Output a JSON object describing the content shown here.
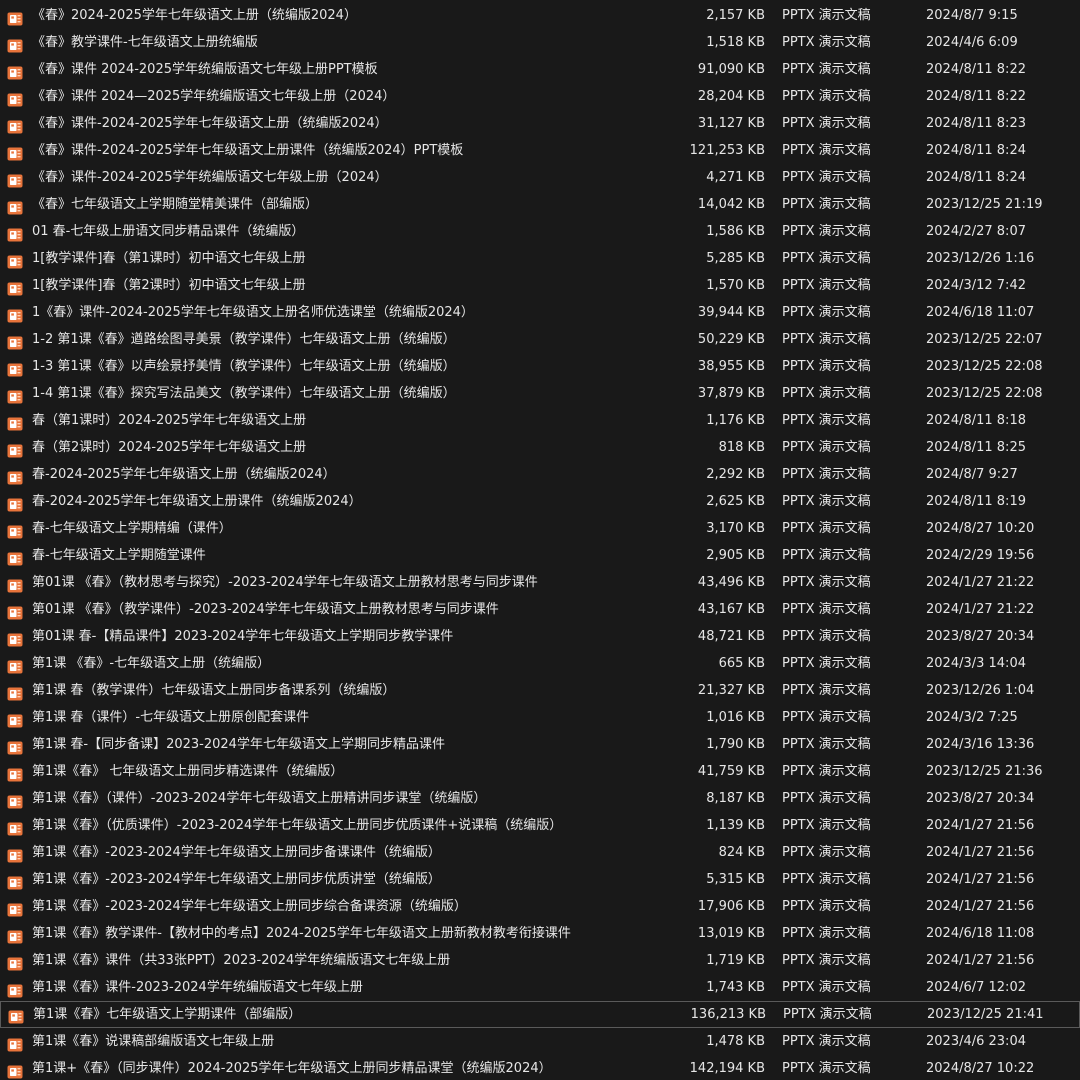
{
  "files": [
    {
      "name": "《春》2024-2025学年七年级语文上册（统编版2024）",
      "size": "2,157 KB",
      "type": "PPTX 演示文稿",
      "date": "2024/8/7 9:15"
    },
    {
      "name": "《春》教学课件-七年级语文上册统编版",
      "size": "1,518 KB",
      "type": "PPTX 演示文稿",
      "date": "2024/4/6 6:09"
    },
    {
      "name": "《春》课件  2024-2025学年统编版语文七年级上册PPT模板",
      "size": "91,090 KB",
      "type": "PPTX 演示文稿",
      "date": "2024/8/11 8:22"
    },
    {
      "name": "《春》课件 2024—2025学年统编版语文七年级上册（2024）",
      "size": "28,204 KB",
      "type": "PPTX 演示文稿",
      "date": "2024/8/11 8:22"
    },
    {
      "name": "《春》课件-2024-2025学年七年级语文上册（统编版2024）",
      "size": "31,127 KB",
      "type": "PPTX 演示文稿",
      "date": "2024/8/11 8:23"
    },
    {
      "name": "《春》课件-2024-2025学年七年级语文上册课件（统编版2024）PPT模板",
      "size": "121,253 KB",
      "type": "PPTX 演示文稿",
      "date": "2024/8/11 8:24"
    },
    {
      "name": "《春》课件-2024-2025学年统编版语文七年级上册（2024）",
      "size": "4,271 KB",
      "type": "PPTX 演示文稿",
      "date": "2024/8/11 8:24"
    },
    {
      "name": "《春》七年级语文上学期随堂精美课件（部编版）",
      "size": "14,042 KB",
      "type": "PPTX 演示文稿",
      "date": "2023/12/25 21:19"
    },
    {
      "name": "01 春-七年级上册语文同步精品课件（统编版）",
      "size": "1,586 KB",
      "type": "PPTX 演示文稿",
      "date": "2024/2/27 8:07"
    },
    {
      "name": "1[教学课件]春（第1课时）初中语文七年级上册",
      "size": "5,285 KB",
      "type": "PPTX 演示文稿",
      "date": "2023/12/26 1:16"
    },
    {
      "name": "1[教学课件]春（第2课时）初中语文七年级上册",
      "size": "1,570 KB",
      "type": "PPTX 演示文稿",
      "date": "2024/3/12 7:42"
    },
    {
      "name": "1《春》课件-2024-2025学年七年级语文上册名师优选课堂（统编版2024）",
      "size": "39,944 KB",
      "type": "PPTX 演示文稿",
      "date": "2024/6/18 11:07"
    },
    {
      "name": "1-2 第1课《春》遒路绘图寻美景（教学课件）七年级语文上册（统编版）",
      "size": "50,229 KB",
      "type": "PPTX 演示文稿",
      "date": "2023/12/25 22:07"
    },
    {
      "name": "1-3 第1课《春》以声绘景抒美情（教学课件）七年级语文上册（统编版）",
      "size": "38,955 KB",
      "type": "PPTX 演示文稿",
      "date": "2023/12/25 22:08"
    },
    {
      "name": "1-4 第1课《春》探究写法品美文（教学课件）七年级语文上册（统编版）",
      "size": "37,879 KB",
      "type": "PPTX 演示文稿",
      "date": "2023/12/25 22:08"
    },
    {
      "name": "春（第1课时）2024-2025学年七年级语文上册",
      "size": "1,176 KB",
      "type": "PPTX 演示文稿",
      "date": "2024/8/11 8:18"
    },
    {
      "name": "春（第2课时）2024-2025学年七年级语文上册",
      "size": "818 KB",
      "type": "PPTX 演示文稿",
      "date": "2024/8/11 8:25"
    },
    {
      "name": "春-2024-2025学年七年级语文上册（统编版2024）",
      "size": "2,292 KB",
      "type": "PPTX 演示文稿",
      "date": "2024/8/7 9:27"
    },
    {
      "name": "春-2024-2025学年七年级语文上册课件（统编版2024）",
      "size": "2,625 KB",
      "type": "PPTX 演示文稿",
      "date": "2024/8/11 8:19"
    },
    {
      "name": "春-七年级语文上学期精编（课件）",
      "size": "3,170 KB",
      "type": "PPTX 演示文稿",
      "date": "2024/8/27 10:20"
    },
    {
      "name": "春-七年级语文上学期随堂课件",
      "size": "2,905 KB",
      "type": "PPTX 演示文稿",
      "date": "2024/2/29 19:56"
    },
    {
      "name": "第01课 《春》（教材思考与探究）-2023-2024学年七年级语文上册教材思考与同步课件",
      "size": "43,496 KB",
      "type": "PPTX 演示文稿",
      "date": "2024/1/27 21:22"
    },
    {
      "name": "第01课 《春》（教学课件）-2023-2024学年七年级语文上册教材思考与同步课件",
      "size": "43,167 KB",
      "type": "PPTX 演示文稿",
      "date": "2024/1/27 21:22"
    },
    {
      "name": "第01课 春-【精品课件】2023-2024学年七年级语文上学期同步教学课件",
      "size": "48,721 KB",
      "type": "PPTX 演示文稿",
      "date": "2023/8/27 20:34"
    },
    {
      "name": "第1课 《春》-七年级语文上册（统编版）",
      "size": "665 KB",
      "type": "PPTX 演示文稿",
      "date": "2024/3/3 14:04"
    },
    {
      "name": "第1课 春（教学课件）七年级语文上册同步备课系列（统编版）",
      "size": "21,327 KB",
      "type": "PPTX 演示文稿",
      "date": "2023/12/26 1:04"
    },
    {
      "name": "第1课 春（课件）-七年级语文上册原创配套课件",
      "size": "1,016 KB",
      "type": "PPTX 演示文稿",
      "date": "2024/3/2 7:25"
    },
    {
      "name": "第1课 春-【同步备课】2023-2024学年七年级语文上学期同步精品课件",
      "size": "1,790 KB",
      "type": "PPTX 演示文稿",
      "date": "2024/3/16 13:36"
    },
    {
      "name": "第1课《春》 七年级语文上册同步精选课件（统编版）",
      "size": "41,759 KB",
      "type": "PPTX 演示文稿",
      "date": "2023/12/25 21:36"
    },
    {
      "name": "第1课《春》（课件）-2023-2024学年七年级语文上册精讲同步课堂（统编版）",
      "size": "8,187 KB",
      "type": "PPTX 演示文稿",
      "date": "2023/8/27 20:34"
    },
    {
      "name": "第1课《春》（优质课件）-2023-2024学年七年级语文上册同步优质课件+说课稿（统编版）",
      "size": "1,139 KB",
      "type": "PPTX 演示文稿",
      "date": "2024/1/27 21:56"
    },
    {
      "name": "第1课《春》-2023-2024学年七年级语文上册同步备课课件（统编版）",
      "size": "824 KB",
      "type": "PPTX 演示文稿",
      "date": "2024/1/27 21:56"
    },
    {
      "name": "第1课《春》-2023-2024学年七年级语文上册同步优质讲堂（统编版）",
      "size": "5,315 KB",
      "type": "PPTX 演示文稿",
      "date": "2024/1/27 21:56"
    },
    {
      "name": "第1课《春》-2023-2024学年七年级语文上册同步综合备课资源（统编版）",
      "size": "17,906 KB",
      "type": "PPTX 演示文稿",
      "date": "2024/1/27 21:56"
    },
    {
      "name": "第1课《春》教学课件-【教材中的考点】2024-2025学年七年级语文上册新教材教考衔接课件",
      "size": "13,019 KB",
      "type": "PPTX 演示文稿",
      "date": "2024/6/18 11:08"
    },
    {
      "name": "第1课《春》课件（共33张PPT）2023-2024学年统编版语文七年级上册",
      "size": "1,719 KB",
      "type": "PPTX 演示文稿",
      "date": "2024/1/27 21:56"
    },
    {
      "name": "第1课《春》课件-2023-2024学年统编版语文七年级上册",
      "size": "1,743 KB",
      "type": "PPTX 演示文稿",
      "date": "2024/6/7 12:02"
    },
    {
      "name": "第1课《春》七年级语文上学期课件（部编版）",
      "size": "136,213 KB",
      "type": "PPTX 演示文稿",
      "date": "2023/12/25 21:41",
      "selected": true
    },
    {
      "name": "第1课《春》说课稿部编版语文七年级上册",
      "size": "1,478 KB",
      "type": "PPTX 演示文稿",
      "date": "2023/4/6 23:04"
    },
    {
      "name": "第1课+《春》（同步课件）2024-2025学年七年级语文上册同步精品课堂（统编版2024）",
      "size": "142,194 KB",
      "type": "PPTX 演示文稿",
      "date": "2024/8/27 10:22"
    }
  ],
  "icon": "pptx-file-icon",
  "colors": {
    "background": "#191919",
    "text": "#e6e6e6",
    "icon_orange": "#e8743b",
    "selection_border": "#5a5a5a"
  }
}
